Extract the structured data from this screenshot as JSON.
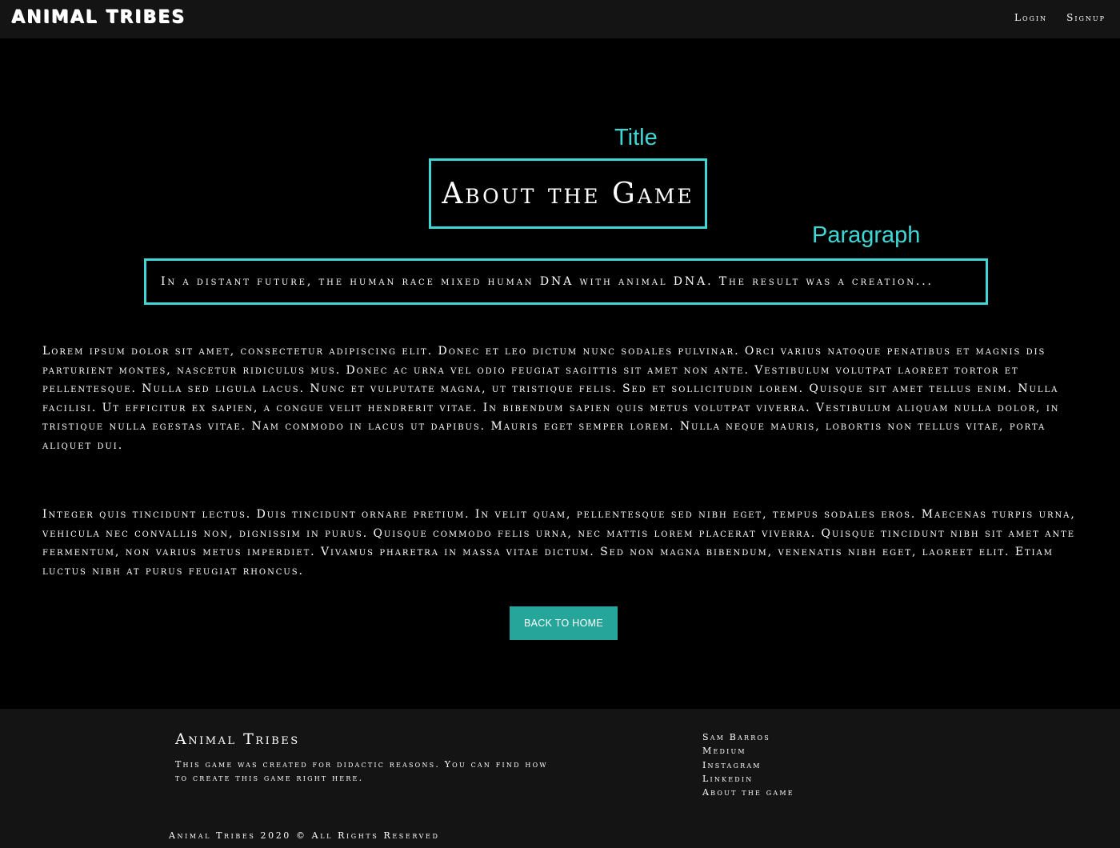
{
  "navbar": {
    "brand": "ANIMAL TRIBES",
    "links": [
      "Login",
      "Signup"
    ]
  },
  "annotations": {
    "title_label": "Title",
    "paragraph_label": "Paragraph",
    "color": "#3fd6d6"
  },
  "main": {
    "title": "About the Game",
    "intro": "In a distant future, the human race mixed human DNA with animal DNA. The result was a creation...",
    "paragraphs": [
      "Lorem ipsum dolor sit amet, consectetur adipiscing elit. Donec et leo dictum nunc sodales pulvinar. Orci varius natoque penatibus et magnis dis parturient montes, nascetur ridiculus mus. Donec ac urna vel odio feugiat sagittis sit amet non ante. Vestibulum volutpat laoreet tortor et pellentesque. Nulla sed ligula lacus. Nunc et vulputate magna, ut tristique felis. Sed et sollicitudin lorem. Quisque sit amet tellus enim. Nulla facilisi. Ut efficitur ex sapien, a congue velit hendrerit vitae. In bibendum sapien quis metus volutpat viverra. Vestibulum aliquam nulla dolor, in tristique nulla egestas vitae. Nam commodo in lacus ut dapibus. Mauris eget semper lorem. Nulla neque mauris, lobortis non tellus vitae, porta aliquet dui.",
      "Integer quis tincidunt lectus. Duis tincidunt ornare pretium. In velit quam, pellentesque sed nibh eget, tempus sodales eros. Maecenas turpis urna, vehicula nec convallis non, dignissim in purus. Quisque commodo felis urna, nec mattis lorem placerat viverra. Quisque tincidunt nibh sit amet ante fermentum, non varius metus imperdiet. Vivamus pharetra in massa vitae dictum. Sed non magna bibendum, venenatis nibh eget, laoreet elit. Etiam luctus nibh at purus feugiat rhoncus."
    ],
    "back_button": "BACK TO HOME",
    "button_color": "#26a69a"
  },
  "footer": {
    "title": "Animal Tribes",
    "description": "This game was created for didactic reasons. You can find how to create this game right here.",
    "links": [
      "Sam Barros",
      "Medium",
      "Instagram",
      "Linkedin",
      "About the game"
    ],
    "copyright": "Animal Tribes 2020 © All Rights Reserved"
  }
}
